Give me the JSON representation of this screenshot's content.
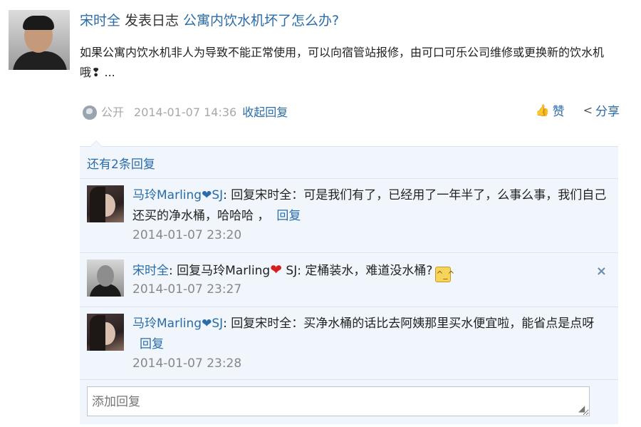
{
  "post": {
    "author": "宋时全",
    "action": "发表日志",
    "title": "公寓内饮水机坏了怎么办?",
    "body": "如果公寓内饮水机非人为导致不能正常使用，可以向宿管站报修，由可口可乐公司维修或更换新的饮水机哦❢ ...",
    "visibility": "公开",
    "time": "2014-01-07 14:36",
    "collapse_label": "收起回复",
    "like_label": "赞",
    "share_label": "分享"
  },
  "replies_section": {
    "more_label": "还有2条回复",
    "input_placeholder": "添加回复",
    "items": [
      {
        "author": "马玲Marling❤SJ",
        "prefix": ": ",
        "text": "回复宋时全：可是我们有了，已经用了一年半了，么事么事，我们自己还买的净水桶，哈哈哈 ，",
        "reply_label": "回复",
        "time": "2014-01-07 23:20"
      },
      {
        "author": "宋时全",
        "prefix": ": ",
        "text_a": "回复马玲Marling",
        "heart": "❤",
        "text_b": " SJ: 定桶装水，难道没水桶?",
        "emoji": "^_^",
        "time": "2014-01-07 23:27",
        "close": "×"
      },
      {
        "author": "马玲Marling❤SJ",
        "prefix": ": ",
        "text": "回复宋时全：买净水桶的话比去阿姨那里买水便宜啦，能省点是点呀",
        "reply_label": "回复",
        "time": "2014-01-07 23:28"
      }
    ]
  },
  "colors": {
    "link": "#2a6ca8",
    "panel": "#f0f6fb",
    "heart": "#d42020"
  }
}
